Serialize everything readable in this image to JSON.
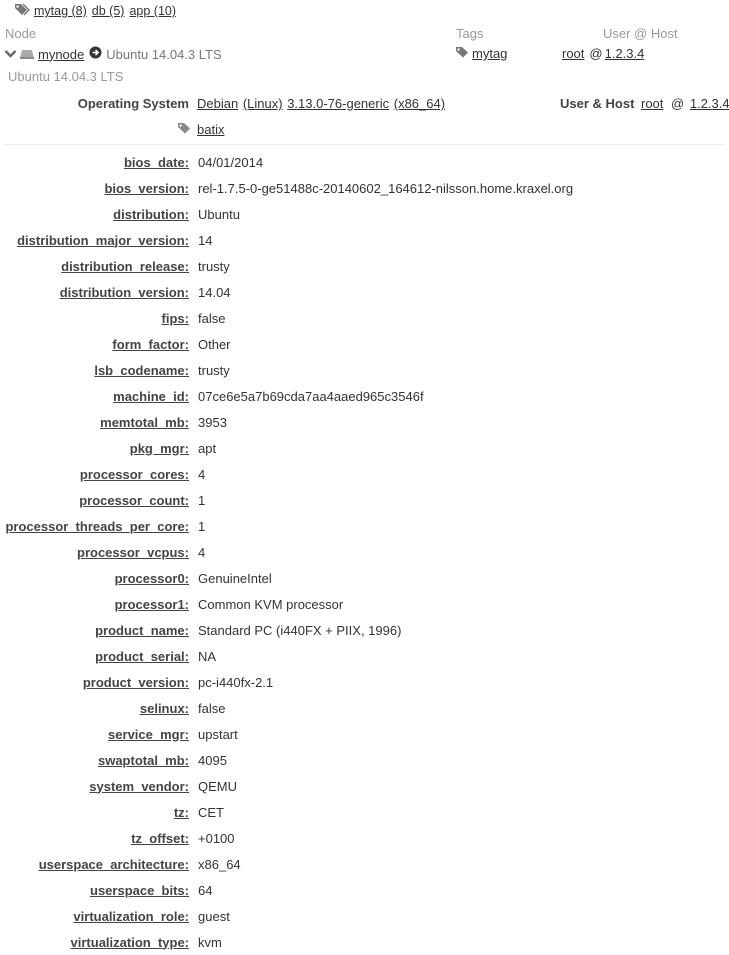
{
  "tag_filter": [
    {
      "label": "mytag (8)"
    },
    {
      "label": "db (5)"
    },
    {
      "label": "app (10)"
    }
  ],
  "header": {
    "node": "Node",
    "tags": "Tags",
    "user_host": "User @ Host"
  },
  "node": {
    "name": "mynode",
    "os": "Ubuntu 14.04.3 LTS",
    "tag": "mytag",
    "user": "root",
    "at": "@",
    "host": "1.2.3.4",
    "description": "Ubuntu 14.04.3 LTS"
  },
  "details": {
    "os_label": "Operating System",
    "os_name": "Debian",
    "os_family": "(Linux)",
    "os_version": "3.13.0-76-generic",
    "os_arch": "(x86_64)",
    "user_host_label": "User & Host",
    "user": "root",
    "at": "@",
    "host": "1.2.3.4",
    "tag": "batix"
  },
  "facts": [
    {
      "key": "bios_date:",
      "value": "04/01/2014"
    },
    {
      "key": "bios_version:",
      "value": "rel-1.7.5-0-ge51488c-20140602_164612-nilsson.home.kraxel.org"
    },
    {
      "key": "distribution:",
      "value": "Ubuntu"
    },
    {
      "key": "distribution_major_version:",
      "value": "14"
    },
    {
      "key": "distribution_release:",
      "value": "trusty"
    },
    {
      "key": "distribution_version:",
      "value": "14.04"
    },
    {
      "key": "fips:",
      "value": "false"
    },
    {
      "key": "form_factor:",
      "value": "Other"
    },
    {
      "key": "lsb_codename:",
      "value": "trusty"
    },
    {
      "key": "machine_id:",
      "value": "07ce6e5a7b69cda7aa4aaed965c3546f"
    },
    {
      "key": "memtotal_mb:",
      "value": "3953"
    },
    {
      "key": "pkg_mgr:",
      "value": "apt"
    },
    {
      "key": "processor_cores:",
      "value": "4"
    },
    {
      "key": "processor_count:",
      "value": "1"
    },
    {
      "key": "processor_threads_per_core:",
      "value": "1"
    },
    {
      "key": "processor_vcpus:",
      "value": "4"
    },
    {
      "key": "processor0:",
      "value": "GenuineIntel"
    },
    {
      "key": "processor1:",
      "value": "Common KVM processor"
    },
    {
      "key": "product_name:",
      "value": "Standard PC (i440FX + PIIX, 1996)"
    },
    {
      "key": "product_serial:",
      "value": "NA"
    },
    {
      "key": "product_version:",
      "value": "pc-i440fx-2.1"
    },
    {
      "key": "selinux:",
      "value": "false"
    },
    {
      "key": "service_mgr:",
      "value": "upstart"
    },
    {
      "key": "swaptotal_mb:",
      "value": "4095"
    },
    {
      "key": "system_vendor:",
      "value": "QEMU"
    },
    {
      "key": "tz:",
      "value": "CET"
    },
    {
      "key": "tz_offset:",
      "value": "+0100"
    },
    {
      "key": "userspace_architecture:",
      "value": "x86_64"
    },
    {
      "key": "userspace_bits:",
      "value": "64"
    },
    {
      "key": "virtualization_role:",
      "value": "guest"
    },
    {
      "key": "virtualization_type:",
      "value": "kvm"
    }
  ]
}
